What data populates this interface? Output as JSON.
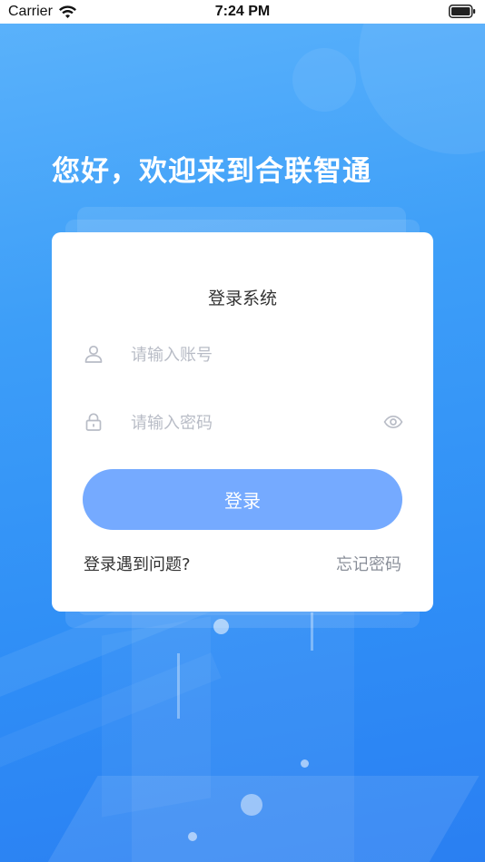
{
  "status_bar": {
    "carrier": "Carrier",
    "time": "7:24 PM"
  },
  "welcome_text": "您好，欢迎来到合联智通",
  "login_card": {
    "title": "登录系统",
    "account_placeholder": "请输入账号",
    "password_placeholder": "请输入密码",
    "login_button": "登录",
    "help_link": "登录遇到问题?",
    "forgot_link": "忘记密码"
  },
  "icons": {
    "account": "user-icon",
    "password": "lock-icon",
    "toggle_visibility": "eye-icon",
    "wifi": "wifi-icon",
    "battery": "battery-icon"
  },
  "colors": {
    "background_top": "#5cb3fb",
    "background_bottom": "#2a7ff2",
    "button": "#75aaff",
    "placeholder": "#b8bcc6"
  }
}
